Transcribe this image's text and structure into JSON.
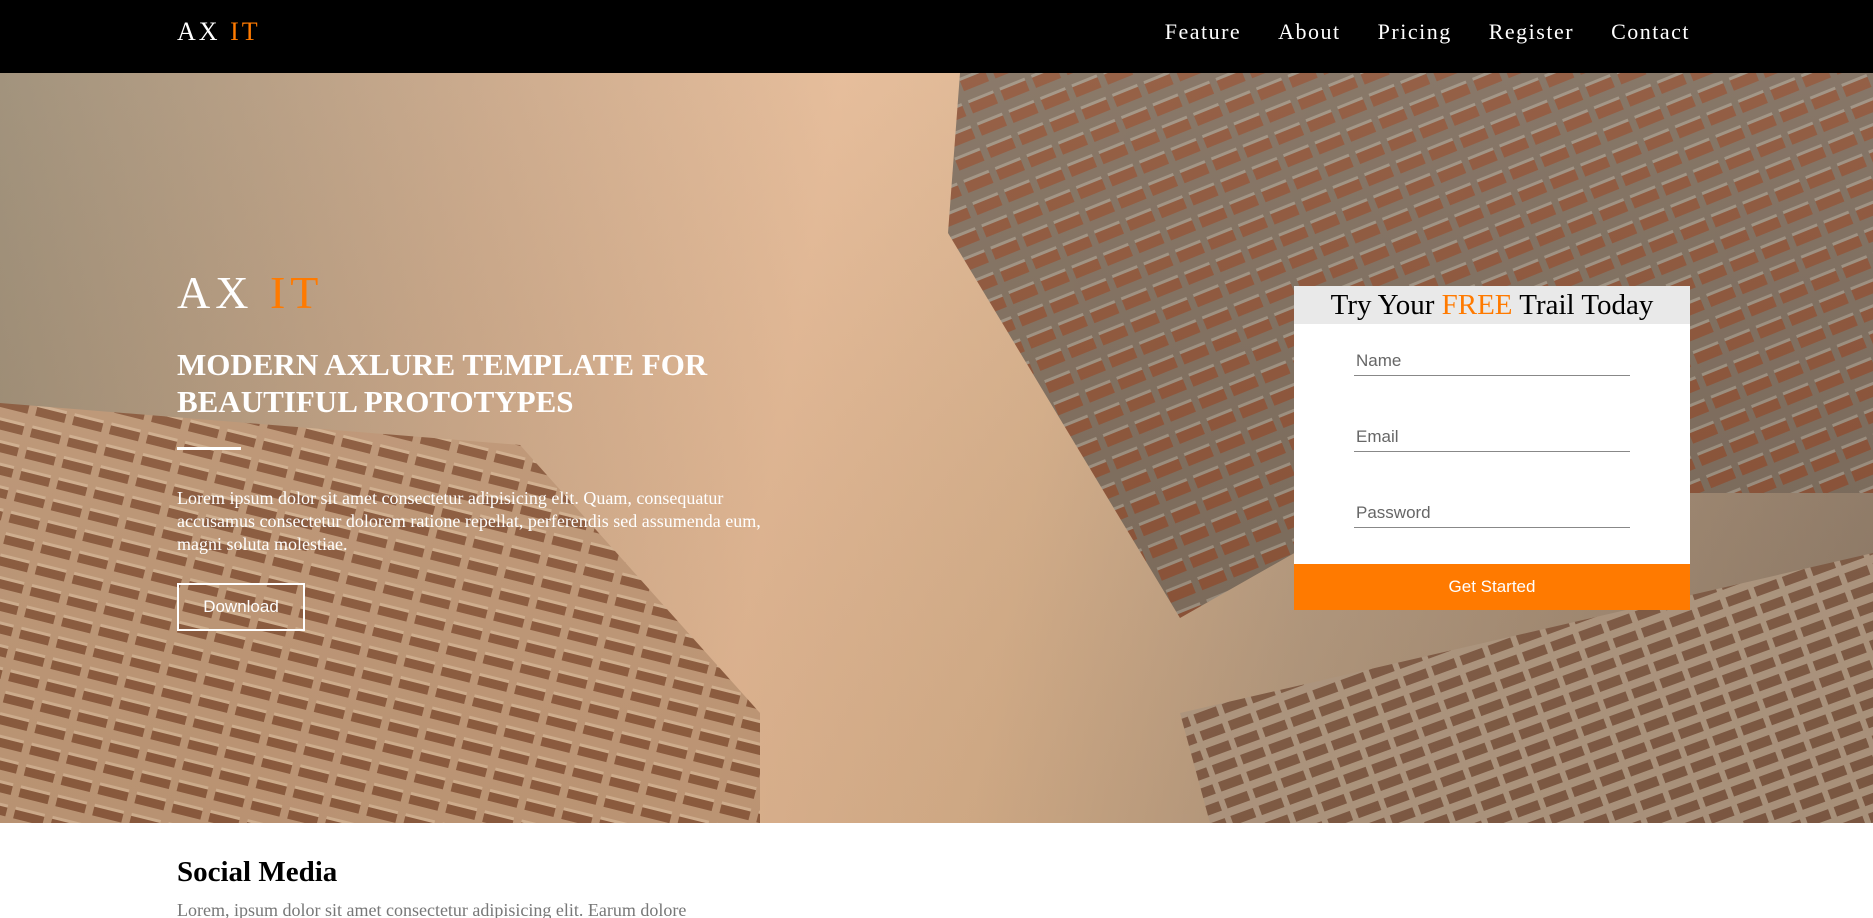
{
  "nav": {
    "brand_main": "AX",
    "brand_accent": "IT",
    "links": [
      "Feature",
      "About",
      "Pricing",
      "Register",
      "Contact"
    ]
  },
  "hero": {
    "brand_main": "AX",
    "brand_accent": "IT",
    "headline": "MODERN AXLURE TEMPLATE FOR BEAUTIFUL PROTOTYPES",
    "body": "Lorem ipsum dolor sit amet consectetur adipisicing elit. Quam, consequatur accusamus consectetur dolorem ratione repellat, perferendis sed assumenda eum, magni soluta molestiae.",
    "download_label": "Download"
  },
  "form": {
    "title_before": "Try Your",
    "title_accent": "FREE",
    "title_after": "Trail Today",
    "name_placeholder": "Name",
    "email_placeholder": "Email",
    "password_placeholder": "Password",
    "submit_label": "Get Started"
  },
  "social": {
    "title": "Social Media",
    "body": "Lorem, ipsum dolor sit amet consectetur adipisicing elit. Earum dolore"
  },
  "colors": {
    "accent": "#ff7a00",
    "nav_bg": "#000000",
    "form_header_bg": "#e9e9e9"
  }
}
